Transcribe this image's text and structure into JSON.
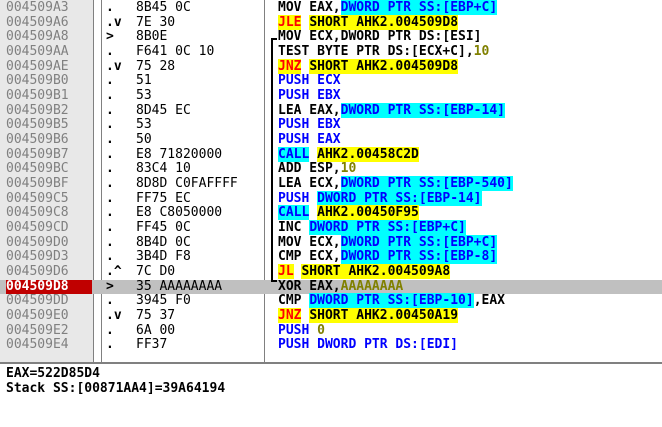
{
  "disassembly": {
    "selected_index": 19,
    "rows": [
      {
        "addr": "004509A3",
        "mark": ".",
        "hex": "8B45 0C",
        "asm": [
          {
            "t": "MOV EAX,"
          },
          {
            "t": "DWORD PTR SS:[EBP+C]",
            "s": "hl-c"
          }
        ]
      },
      {
        "addr": "004509A6",
        "mark": ".v",
        "hex": "7E 30",
        "asm": [
          {
            "t": "JLE",
            "s": "hl-y red"
          },
          {
            "t": " "
          },
          {
            "t": "SHORT AHK2.004509D8",
            "s": "hl-y"
          }
        ]
      },
      {
        "addr": "004509A8",
        "mark": ">",
        "hex": "8B0E",
        "asm": [
          {
            "t": "MOV ECX,DWORD PTR DS:[ESI]"
          }
        ]
      },
      {
        "addr": "004509AA",
        "mark": ".",
        "hex": "F641 0C 10",
        "asm": [
          {
            "t": "TEST BYTE PTR DS:[ECX+C],"
          },
          {
            "t": "10",
            "s": "olive"
          }
        ]
      },
      {
        "addr": "004509AE",
        "mark": ".v",
        "hex": "75 28",
        "asm": [
          {
            "t": "JNZ",
            "s": "hl-y red"
          },
          {
            "t": " "
          },
          {
            "t": "SHORT AHK2.004509D8",
            "s": "hl-y"
          }
        ]
      },
      {
        "addr": "004509B0",
        "mark": ".",
        "hex": "51",
        "asm": [
          {
            "t": "PUSH ECX",
            "s": "blue"
          }
        ]
      },
      {
        "addr": "004509B1",
        "mark": ".",
        "hex": "53",
        "asm": [
          {
            "t": "PUSH EBX",
            "s": "blue"
          }
        ]
      },
      {
        "addr": "004509B2",
        "mark": ".",
        "hex": "8D45 EC",
        "asm": [
          {
            "t": "LEA EAX,"
          },
          {
            "t": "DWORD PTR SS:[EBP-14]",
            "s": "hl-c"
          }
        ]
      },
      {
        "addr": "004509B5",
        "mark": ".",
        "hex": "53",
        "asm": [
          {
            "t": "PUSH EBX",
            "s": "blue"
          }
        ]
      },
      {
        "addr": "004509B6",
        "mark": ".",
        "hex": "50",
        "asm": [
          {
            "t": "PUSH EAX",
            "s": "blue"
          }
        ]
      },
      {
        "addr": "004509B7",
        "mark": ".",
        "hex": "E8 71820000",
        "asm": [
          {
            "t": "CALL",
            "s": "hl-c"
          },
          {
            "t": " "
          },
          {
            "t": "AHK2.00458C2D",
            "s": "hl-y"
          }
        ]
      },
      {
        "addr": "004509BC",
        "mark": ".",
        "hex": "83C4 10",
        "asm": [
          {
            "t": "ADD ESP,"
          },
          {
            "t": "10",
            "s": "olive"
          }
        ]
      },
      {
        "addr": "004509BF",
        "mark": ".",
        "hex": "8D8D C0FAFFFF",
        "asm": [
          {
            "t": "LEA ECX,"
          },
          {
            "t": "DWORD PTR SS:[EBP-540]",
            "s": "hl-c"
          }
        ]
      },
      {
        "addr": "004509C5",
        "mark": ".",
        "hex": "FF75 EC",
        "asm": [
          {
            "t": "PUSH ",
            "s": "blue"
          },
          {
            "t": "DWORD PTR SS:[EBP-14]",
            "s": "hl-c"
          }
        ]
      },
      {
        "addr": "004509C8",
        "mark": ".",
        "hex": "E8 C8050000",
        "asm": [
          {
            "t": "CALL",
            "s": "hl-c"
          },
          {
            "t": " "
          },
          {
            "t": "AHK2.00450F95",
            "s": "hl-y"
          }
        ]
      },
      {
        "addr": "004509CD",
        "mark": ".",
        "hex": "FF45 0C",
        "asm": [
          {
            "t": "INC "
          },
          {
            "t": "DWORD PTR SS:[EBP+C]",
            "s": "hl-c"
          }
        ]
      },
      {
        "addr": "004509D0",
        "mark": ".",
        "hex": "8B4D 0C",
        "asm": [
          {
            "t": "MOV ECX,"
          },
          {
            "t": "DWORD PTR SS:[EBP+C]",
            "s": "hl-c"
          }
        ]
      },
      {
        "addr": "004509D3",
        "mark": ".",
        "hex": "3B4D F8",
        "asm": [
          {
            "t": "CMP ECX,"
          },
          {
            "t": "DWORD PTR SS:[EBP-8]",
            "s": "hl-c"
          }
        ]
      },
      {
        "addr": "004509D6",
        "mark": ".^",
        "hex": "7C D0",
        "asm": [
          {
            "t": "JL",
            "s": "hl-y red"
          },
          {
            "t": " "
          },
          {
            "t": "SHORT AHK2.004509A8",
            "s": "hl-y"
          }
        ]
      },
      {
        "addr": "004509D8",
        "mark": ">",
        "hex": "35 AAAAAAAA",
        "asm": [
          {
            "t": "XOR EAX,"
          },
          {
            "t": "AAAAAAAA",
            "s": "olive"
          }
        ]
      },
      {
        "addr": "004509DD",
        "mark": ".",
        "hex": "3945 F0",
        "asm": [
          {
            "t": "CMP "
          },
          {
            "t": "DWORD PTR SS:[EBP-10]",
            "s": "hl-c"
          },
          {
            "t": ",EAX"
          }
        ]
      },
      {
        "addr": "004509E0",
        "mark": ".v",
        "hex": "75 37",
        "asm": [
          {
            "t": "JNZ",
            "s": "hl-y red"
          },
          {
            "t": " "
          },
          {
            "t": "SHORT AHK2.00450A19",
            "s": "hl-y"
          }
        ]
      },
      {
        "addr": "004509E2",
        "mark": ".",
        "hex": "6A 00",
        "asm": [
          {
            "t": "PUSH ",
            "s": "blue"
          },
          {
            "t": "0",
            "s": "olive"
          }
        ]
      },
      {
        "addr": "004509E4",
        "mark": ".",
        "hex": "FF37",
        "asm": [
          {
            "t": "PUSH DWORD PTR DS:[EDI]",
            "s": "blue"
          }
        ]
      }
    ]
  },
  "info": {
    "line1": "EAX=522D85D4",
    "line2": "Stack SS:[00871AA4]=39A64194"
  }
}
